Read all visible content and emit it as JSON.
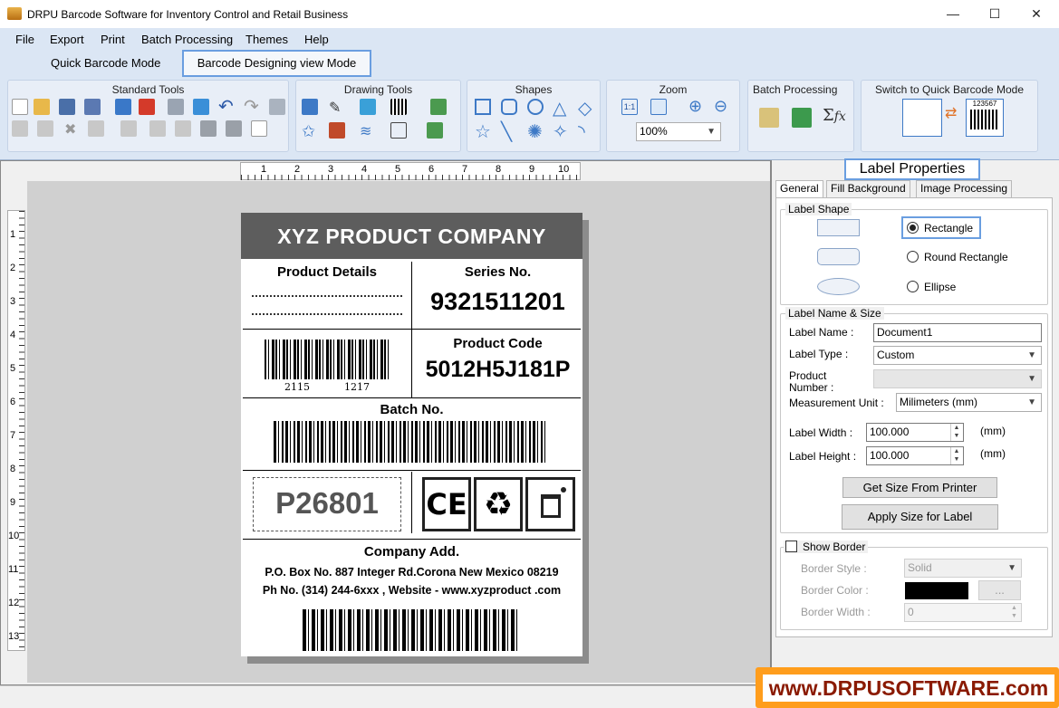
{
  "window": {
    "title": "DRPU Barcode Software for Inventory Control and Retail Business",
    "minimize": "—",
    "maximize": "☐",
    "close": "✕"
  },
  "menu": [
    "File",
    "Export",
    "Print",
    "Batch Processing",
    "Themes",
    "Help"
  ],
  "modes": {
    "quick": "Quick Barcode Mode",
    "design": "Barcode Designing view Mode"
  },
  "ribbon": {
    "standard_tools": "Standard Tools",
    "drawing_tools": "Drawing Tools",
    "shapes": "Shapes",
    "zoom": "Zoom",
    "zoom_value": "100%",
    "batch_processing": "Batch Processing",
    "switch_mode": "Switch to Quick Barcode Mode",
    "switch_barcode_number": "123567"
  },
  "ruler": {
    "h_ticks": [
      "1",
      "2",
      "3",
      "4",
      "5",
      "6",
      "7",
      "8",
      "9",
      "10"
    ],
    "v_ticks": [
      "1",
      "2",
      "3",
      "4",
      "5",
      "6",
      "7",
      "8",
      "9",
      "10",
      "11",
      "12",
      "13"
    ]
  },
  "label": {
    "header": "XYZ PRODUCT COMPANY",
    "product_details": "Product Details",
    "series_title": "Series No.",
    "series_value": "9321511201",
    "barcode_left_num": "2115",
    "barcode_right_num": "1217",
    "product_code_title": "Product Code",
    "product_code_value": "5012H5J181P",
    "batch_title": "Batch No.",
    "stamp": "P26801",
    "ce_mark": "CE",
    "company_add_title": "Company Add.",
    "address_line": "P.O. Box No. 887 Integer Rd.Corona New Mexico 08219",
    "contact_line": "Ph No. (314) 244-6xxx , Website - www.xyzproduct .com"
  },
  "props": {
    "title": "Label Properties",
    "tabs": [
      "General",
      "Fill Background",
      "Image Processing"
    ],
    "label_shape": "Label Shape",
    "shapes": [
      "Rectangle",
      "Round Rectangle",
      "Ellipse"
    ],
    "selected_shape": "Rectangle",
    "name_size": "Label  Name & Size",
    "label_name_lbl": "Label Name :",
    "label_name_val": "Document1",
    "label_type_lbl": "Label Type :",
    "label_type_val": "Custom",
    "product_number_lbl1": "Product",
    "product_number_lbl2": "Number :",
    "product_number_val": "",
    "measurement_lbl": "Measurement Unit :",
    "measurement_val": "Milimeters (mm)",
    "width_lbl": "Label Width :",
    "width_val": "100.000",
    "height_lbl": "Label Height :",
    "height_val": "100.000",
    "unit": "(mm)",
    "get_size_btn": "Get Size From Printer",
    "apply_size_btn": "Apply Size for Label",
    "show_border": "Show Border",
    "border_style_lbl": "Border Style :",
    "border_style_val": "Solid",
    "border_color_lbl": "Border Color :",
    "border_color_hex": "#000000",
    "border_color_btn": "...",
    "border_width_lbl": "Border Width :",
    "border_width_val": "0"
  },
  "watermark": "www.DRPUSOFTWARE.com"
}
